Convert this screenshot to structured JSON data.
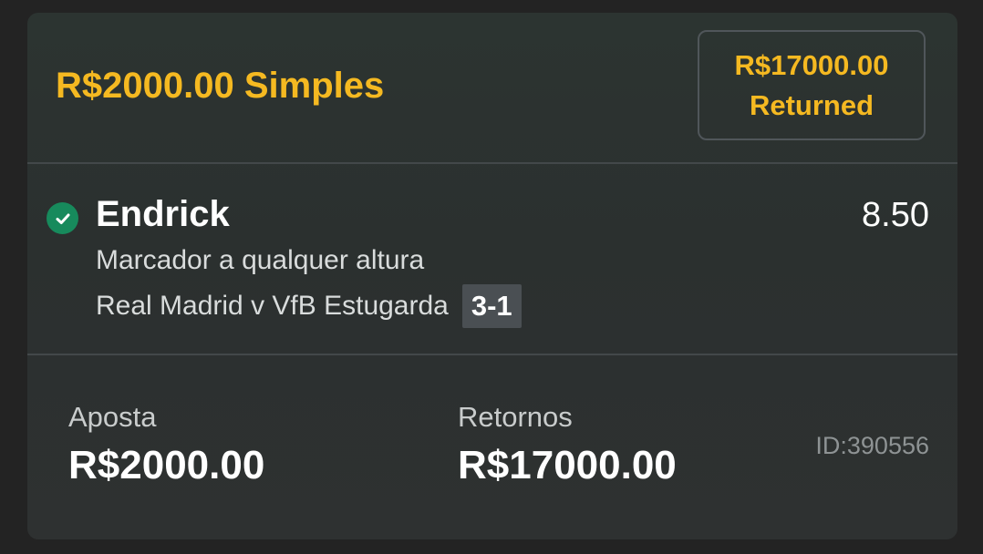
{
  "bet": {
    "title": "R$2000.00 Simples",
    "returned_amount": "R$17000.00",
    "returned_label": "Returned"
  },
  "selection": {
    "status_icon": "check-circle-icon",
    "player": "Endrick",
    "odds": "8.50",
    "market": "Marcador a qualquer altura",
    "event": "Real Madrid v VfB Estugarda",
    "score": "3-1"
  },
  "summary": {
    "stake_label": "Aposta",
    "stake_value": "R$2000.00",
    "returns_label": "Retornos",
    "returns_value": "R$17000.00",
    "bet_id": "ID:390556"
  },
  "colors": {
    "accent": "#f5b921",
    "win_green": "#178a5c",
    "card_bg": "#2c3331",
    "page_bg": "#232323"
  }
}
